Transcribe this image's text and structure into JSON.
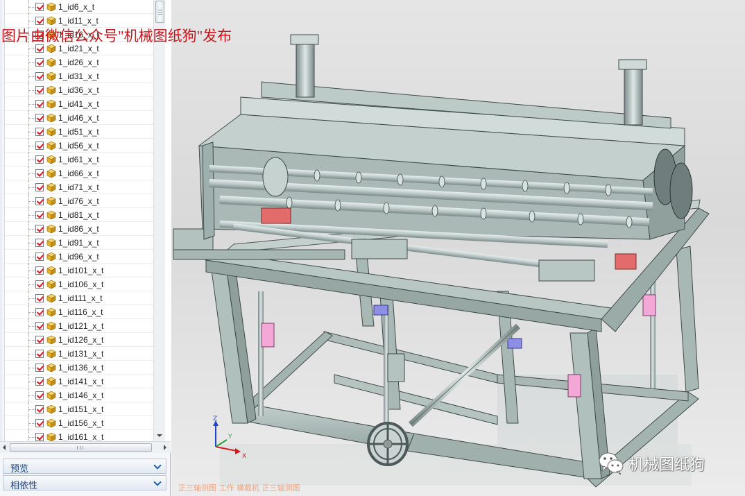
{
  "watermark": "图片由微信公众号\"机械图纸狗\"发布",
  "tree": {
    "first_item": "1_id6_x_t",
    "items": [
      "1_id11_x_t",
      "1_id16_x_t",
      "1_id21_x_t",
      "1_id26_x_t",
      "1_id31_x_t",
      "1_id36_x_t",
      "1_id41_x_t",
      "1_id46_x_t",
      "1_id51_x_t",
      "1_id56_x_t",
      "1_id61_x_t",
      "1_id66_x_t",
      "1_id71_x_t",
      "1_id76_x_t",
      "1_id81_x_t",
      "1_id86_x_t",
      "1_id91_x_t",
      "1_id96_x_t",
      "1_id101_x_t",
      "1_id106_x_t",
      "1_id111_x_t",
      "1_id116_x_t",
      "1_id121_x_t",
      "1_id126_x_t",
      "1_id131_x_t",
      "1_id136_x_t",
      "1_id141_x_t",
      "1_id146_x_t",
      "1_id151_x_t",
      "1_id156_x_t",
      "1_id161_x_t"
    ]
  },
  "panels": {
    "preview_label": "预览",
    "dependency_label": "相依性"
  },
  "viewport": {
    "status_text": "正三轴测图 工作 横截机 正三轴测图",
    "axis_z": "Z",
    "axis_x": "X",
    "axis_y": "Y"
  },
  "badge": {
    "text": "机械图纸狗",
    "icon": "wechat-icon"
  },
  "colors": {
    "checkbox_check": "#d8171f",
    "part_icon": "#e8b32a",
    "machine_body": "#a9bab7",
    "accent_pink": "#f3a8d8",
    "accent_red": "#e46b6b",
    "watermark": "#c7161c"
  }
}
